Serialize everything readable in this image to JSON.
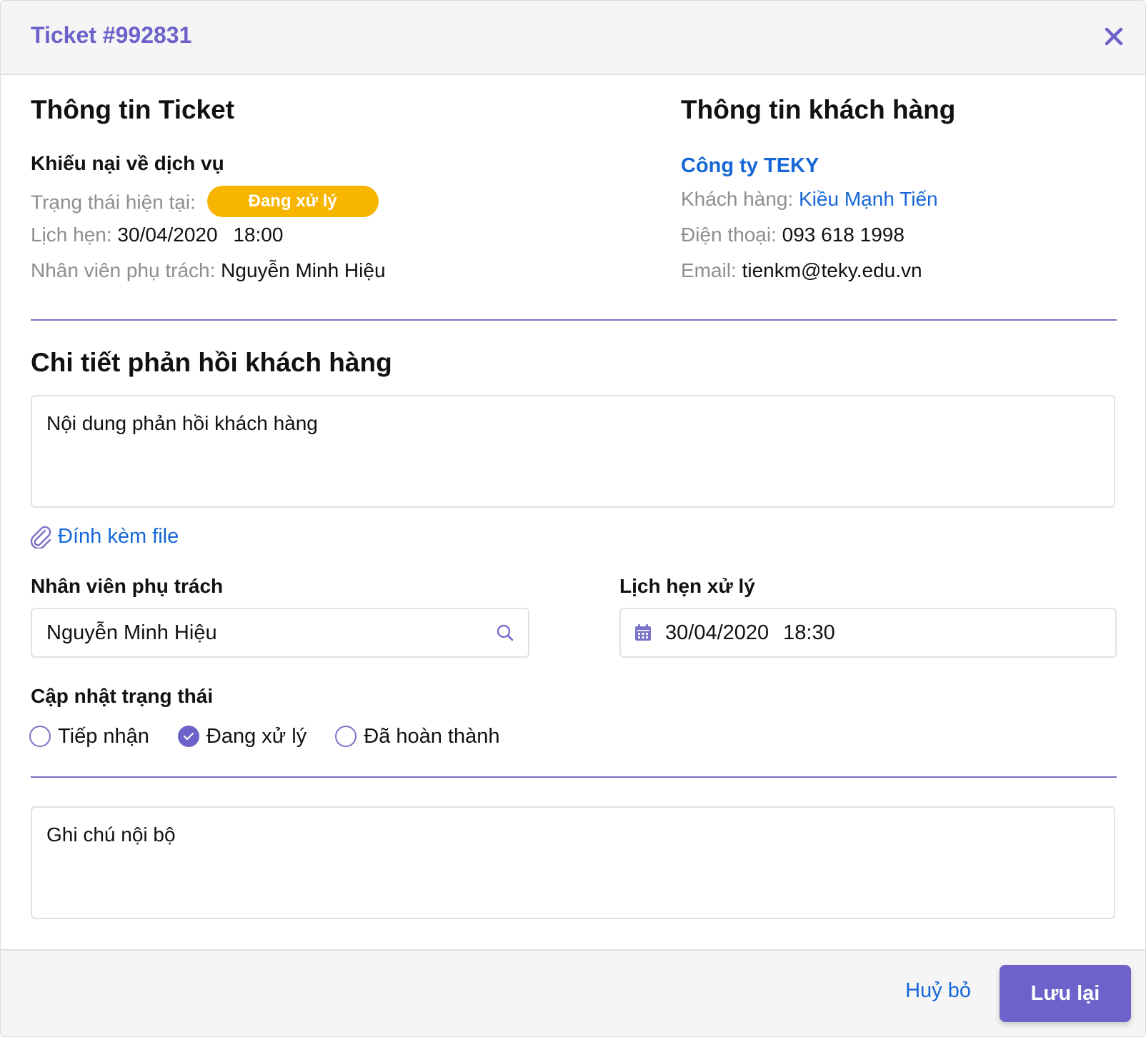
{
  "header": {
    "title": "Ticket #992831",
    "close_icon": "close-icon"
  },
  "ticket_info": {
    "heading": "Thông tin Ticket",
    "category": "Khiếu nại về dịch vụ",
    "status_label": "Trạng thái hiện tại:",
    "status_value": "Đang xử lý",
    "status_color": "#f7b500",
    "appointment_label": "Lịch hẹn:",
    "appointment_date": "30/04/2020",
    "appointment_time": "18:00",
    "staff_label": "Nhân viên phụ trách:",
    "staff_value": "Nguyễn Minh Hiệu"
  },
  "customer_info": {
    "heading": "Thông tin khách hàng",
    "company": "Công ty TEKY",
    "customer_label": "Khách hàng:",
    "customer_value": "Kiều Mạnh Tiến",
    "phone_label": "Điện thoại:",
    "phone_value": "093 618 1998",
    "email_label": "Email:",
    "email_value": "tienkm@teky.edu.vn"
  },
  "feedback": {
    "heading": "Chi tiết phản hồi khách hàng",
    "content_placeholder": "Nội dung phản hồi khách hàng",
    "attach_label": "Đính kèm file",
    "attach_icon": "paperclip-icon"
  },
  "form": {
    "staff_label": "Nhân viên phụ trách",
    "staff_value": "Nguyễn Minh Hiệu",
    "staff_icon": "search-icon",
    "schedule_label": "Lịch hẹn xử lý",
    "schedule_date": "30/04/2020",
    "schedule_time": "18:30",
    "schedule_icon": "calendar-icon",
    "status_update_label": "Cập nhật trạng thái",
    "status_options": [
      {
        "label": "Tiếp nhận",
        "checked": false
      },
      {
        "label": "Đang xử lý",
        "checked": true
      },
      {
        "label": "Đã hoàn thành",
        "checked": false
      }
    ],
    "internal_note_placeholder": "Ghi chú nội bộ"
  },
  "footer": {
    "cancel_label": "Huỷ bỏ",
    "save_label": "Lưu lại"
  },
  "colors": {
    "accent": "#6c62c9",
    "link": "#1667d6",
    "status": "#f7b500"
  }
}
